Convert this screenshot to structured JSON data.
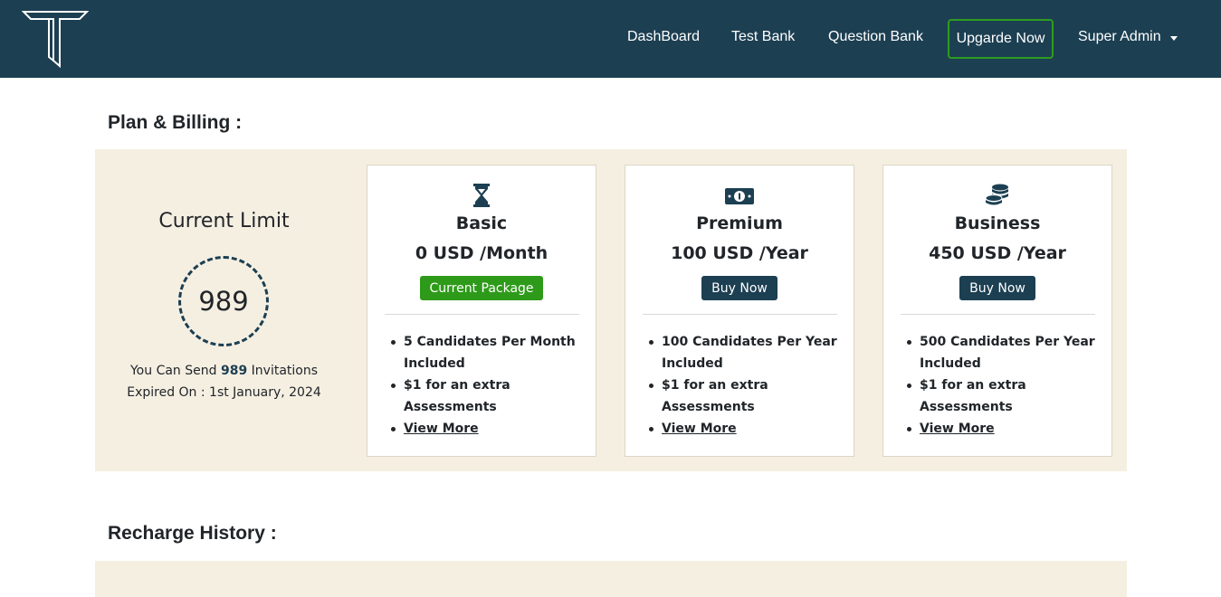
{
  "nav": {
    "links": [
      "DashBoard",
      "Test Bank",
      "Question Bank"
    ],
    "upgrade_label": "Upgarde Now",
    "user_label": "Super Admin"
  },
  "plan_section": {
    "title": "Plan & Billing :"
  },
  "current_limit": {
    "title": "Current Limit",
    "value": "989",
    "send_prefix": "You Can Send",
    "send_count": "989",
    "send_suffix": "Invitations",
    "expiry": "Expired On : 1st January, 2024"
  },
  "plans": [
    {
      "icon": "hourglass-icon",
      "name": "Basic",
      "price": "0 USD /Month",
      "button": "Current Package",
      "features": [
        "5 Candidates Per Month Included",
        "$1 for an extra Assessments",
        "View More"
      ]
    },
    {
      "icon": "money-bill-icon",
      "name": "Premium",
      "price": "100 USD /Year",
      "button": "Buy Now",
      "features": [
        "100 Candidates Per Year Included",
        "$1 for an extra Assessments",
        "View More"
      ]
    },
    {
      "icon": "coins-icon",
      "name": "Business",
      "price": "450 USD /Year",
      "button": "Buy Now",
      "features": [
        "500 Candidates Per Year Included",
        "$1 for an extra Assessments",
        "View More"
      ]
    }
  ],
  "history_section": {
    "title": "Recharge History :"
  },
  "colors": {
    "navbar": "#1c3f52",
    "panel": "#f5efe2",
    "accent_green": "#2e9a1a",
    "accent_dark": "#1c3f52"
  }
}
